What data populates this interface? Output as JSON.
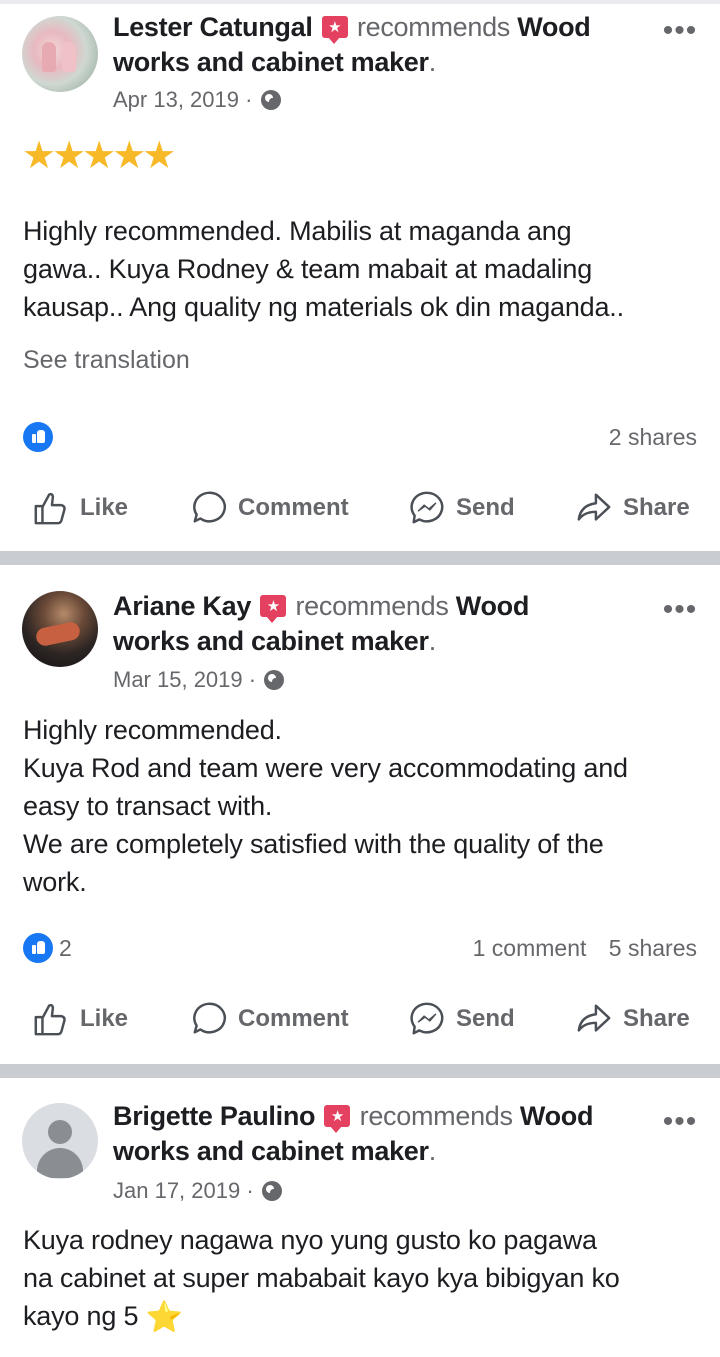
{
  "posts": [
    {
      "author": "Lester Catungal",
      "recommends": "recommends",
      "page_a": "Wood",
      "page_b": "works and cabinet maker",
      "period": ".",
      "date": "Apr 13, 2019 ·",
      "rating": "★★★★★",
      "text": "Highly recommended. Mabilis at maganda ang\ngawa.. Kuya Rodney & team mabait at madaling\nkausap.. Ang quality ng materials ok din maganda..",
      "see_translation": "See translation",
      "reaction_count": "",
      "comments": "",
      "shares": "2 shares"
    },
    {
      "author": "Ariane Kay",
      "recommends": "recommends",
      "page_a": "Wood",
      "page_b": "works and cabinet maker",
      "period": ".",
      "date": "Mar 15, 2019 ·",
      "text": "Highly recommended.\nKuya Rod and team were very accommodating and\neasy to  transact with.\nWe are completely satisfied with the quality of the\nwork.",
      "reaction_count": "2",
      "comments": "1 comment",
      "shares": "5 shares"
    },
    {
      "author": "Brigette Paulino",
      "recommends": "recommends",
      "page_a": "Wood",
      "page_b": "works and cabinet maker",
      "period": ".",
      "date": "Jan 17, 2019 ·",
      "text": "Kuya rodney nagawa nyo yung gusto ko pagawa\nna cabinet at super mababait kayo kya bibigyan ko\nkayo ng 5",
      "text_star": "⭐"
    }
  ],
  "actions": {
    "like": "Like",
    "comment": "Comment",
    "send": "Send",
    "share": "Share"
  },
  "more_glyph": "•••",
  "recommend_badge_glyph": "★",
  "colors": {
    "text": "#1c1e21",
    "secondary": "#65676b",
    "like_blue": "#1877f2",
    "badge_red": "#e4405f",
    "star_gold": "#f7b928",
    "divider": "#c9ccd1"
  },
  "icons": [
    "more-icon",
    "recommend-badge-icon",
    "globe-icon",
    "like-reaction-icon",
    "like-icon",
    "comment-icon",
    "messenger-icon",
    "share-icon",
    "star-icon"
  ]
}
